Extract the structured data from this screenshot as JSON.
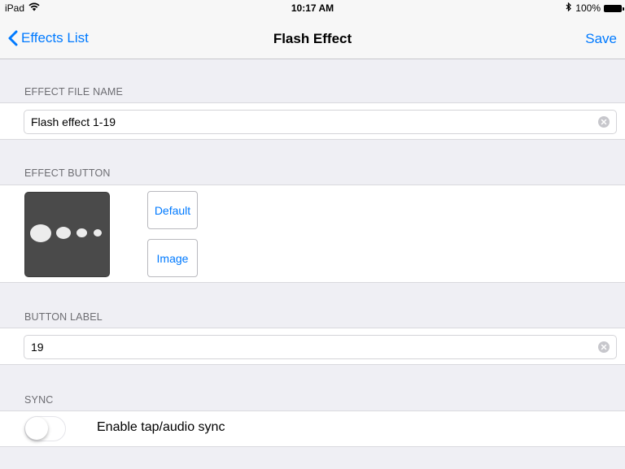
{
  "status_bar": {
    "device": "iPad",
    "time": "10:17 AM",
    "battery": "100%"
  },
  "nav": {
    "back_label": "Effects List",
    "title": "Flash Effect",
    "save_label": "Save"
  },
  "sections": {
    "file_name": {
      "header": "EFFECT FILE NAME",
      "value": "Flash effect 1-19"
    },
    "effect_button": {
      "header": "EFFECT BUTTON",
      "default_label": "Default",
      "image_label": "Image"
    },
    "button_label": {
      "header": "BUTTON LABEL",
      "value": "19"
    },
    "sync": {
      "header": "SYNC",
      "toggle_label": "Enable tap/audio sync",
      "toggle_on": false
    }
  },
  "colors": {
    "accent": "#007aff",
    "background": "#efeff4",
    "preview_bg": "#4a4a4a"
  }
}
